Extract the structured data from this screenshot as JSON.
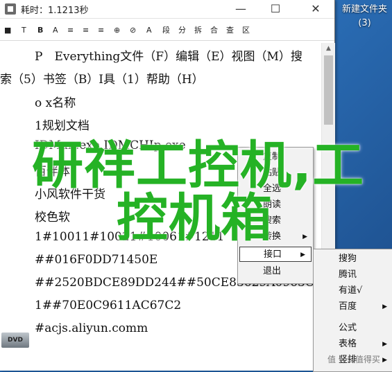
{
  "window": {
    "title": "耗时：1.1213秒",
    "controls": [
      "—",
      "☐",
      "✕"
    ]
  },
  "toolbar": {
    "items": [
      "■",
      "T",
      "B",
      "A",
      "≡",
      "≡",
      "≡",
      "⊕",
      "⊘",
      "A",
      "段",
      "分",
      "拆",
      "合",
      "查",
      "区"
    ]
  },
  "document": {
    "lines": [
      "P　Everything文件（F）编辑（E）视图（M）搜",
      "索（5）书签（B）I具（1）帮助（H）",
      "o x名称",
      "1规划文档",
      "IDMan.exe IDMCHIp.exe",
      "百伴体",
      "小风软件干货",
      "校色软",
      "1#10011#10021#10061#1211",
      "##016F0DD71450E",
      "##2520BDCE89DD244##50CE83629A0963CD",
      "1##70E0C9611AC67C2",
      "#acjs.aliyun.comm"
    ]
  },
  "context_menu": {
    "items": [
      {
        "label": "复制",
        "submenu": false
      },
      {
        "label": "粘贴",
        "submenu": false
      },
      {
        "label": "全选",
        "submenu": false
      },
      {
        "label": "朗读",
        "submenu": false
      },
      {
        "label": "搜索",
        "submenu": false
      },
      {
        "label": "转换",
        "submenu": true
      },
      {
        "label": "接口",
        "submenu": true,
        "highlighted": true
      },
      {
        "label": "退出",
        "submenu": false
      }
    ]
  },
  "submenu": {
    "items": [
      {
        "label": "搜狗",
        "submenu": false
      },
      {
        "label": "腾讯",
        "submenu": false
      },
      {
        "label": "有道√",
        "submenu": false
      },
      {
        "label": "百度",
        "submenu": true
      },
      {
        "label": "公式",
        "submenu": false
      },
      {
        "label": "表格",
        "submenu": true
      },
      {
        "label": "竖排",
        "submenu": true
      }
    ]
  },
  "overlay": {
    "line1": "研祥工控机,工",
    "line2": "控机箱"
  },
  "desktop": {
    "folder_label": "新建文件夹",
    "folder_count": "(3)",
    "dvd_label": "DVD"
  },
  "watermark": "值 什么值得买",
  "colors": {
    "overlay_green": "#25b225",
    "desktop_blue": "#1f5fa6"
  }
}
